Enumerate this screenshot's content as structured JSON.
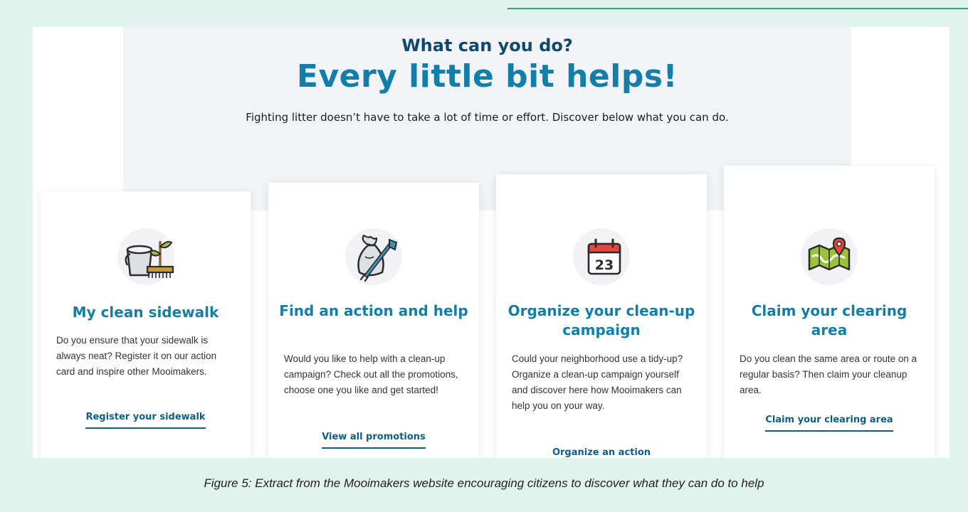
{
  "hero": {
    "eyebrow": "What can you do?",
    "headline": "Every little bit helps!",
    "intro": "Fighting litter doesn’t have to take a lot of time or effort. Discover below what you can do."
  },
  "cards": [
    {
      "icon": "bucket-broom-icon",
      "title": "My clean sidewalk",
      "text": "Do you ensure that your sidewalk is always neat? Register it on our action card and inspire other Mooimakers.",
      "link": "Register your sidewalk"
    },
    {
      "icon": "trash-bag-grabber-icon",
      "title": "Find an action and help",
      "text": "Would you like to help with a clean-up campaign? Check out all the promotions, choose one you like and get started!",
      "link": "View all promotions"
    },
    {
      "icon": "calendar-icon",
      "calendar_day": "23",
      "title": "Organize your clean-up campaign",
      "text": "Could your neighborhood use a tidy-up? Organize a clean-up campaign yourself and discover here how Mooimakers can help you on your way.",
      "link": "Organize an action"
    },
    {
      "icon": "map-pin-icon",
      "title": "Claim your clearing area",
      "text": "Do you clean the same area or route on a regular basis? Then claim your cleanup area.",
      "link": "Claim your clearing area"
    }
  ],
  "caption": "Figure 5: Extract from the Mooimakers website encouraging citizens to discover what they can do to help",
  "colors": {
    "background": "#e0f3ed",
    "accent": "#127eaa",
    "dark_heading": "#0f4a6e",
    "link": "#0c5f86",
    "top_rule": "#2aa58a"
  }
}
